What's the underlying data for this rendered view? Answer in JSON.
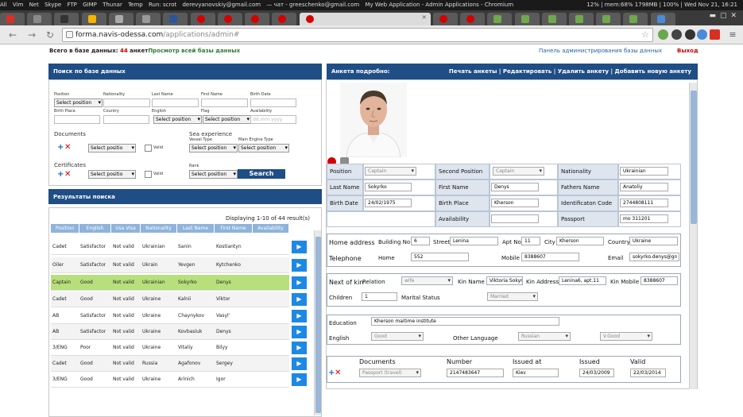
{
  "system": {
    "left_items": [
      "All",
      "Vim",
      "Net",
      "Skype",
      "FTP",
      "GIMP",
      "Thunar",
      "Temp",
      "Run: scrot"
    ],
    "chat_email": "derevyanovskiy@gmail.com",
    "chat_rest": "— чат - greeschenko@gmail.com",
    "window_title": "My Web Application - Admin Applications - Chromium",
    "status": "12% | mem:68% 1798MB | 100% | Wed Nov 21, 16:21"
  },
  "browser": {
    "url_host": "forma.navis-odessa.com",
    "url_path": "/applications/admin#"
  },
  "page": {
    "stats_prefix": "Всего в базе данных: ",
    "stats_count": "44",
    "stats_suffix": " анкет",
    "view_all": "Просмотр всей базы данных",
    "admin_panel": "Панель администрирования базы данных",
    "logout": "Выход"
  },
  "search": {
    "header": "Поиск по базе данных",
    "labels": {
      "position": "Position",
      "nationality": "Nationality",
      "last_name": "Last Name",
      "first_name": "First Name",
      "birth_date": "Birth Date",
      "birth_place": "Birth Place",
      "country": "Country",
      "english": "English",
      "flag": "Flag",
      "availability": "Availability",
      "documents": "Documents",
      "certificates": "Certificates",
      "sea_experience": "Sea experience",
      "vessel_type": "Vessel Type",
      "main_engine_type": "Main Engine Type",
      "rank": "Rank",
      "valid": "Valid"
    },
    "select_position": "Select position",
    "select_position_short": "Select positio",
    "date_placeholder": "dd.mm.yyyy",
    "button": "Search"
  },
  "results": {
    "header": "Результаты поиска",
    "displaying": "Displaying 1-10 of 44 result(s)",
    "columns": [
      "Position",
      "English",
      "Usa Visa",
      "Nationality",
      "Last Name",
      "First Name",
      "Availability"
    ],
    "rows": [
      [
        "Cadet",
        "Satisfactor",
        "Not valid",
        "Ukrainian",
        "Sanin",
        "Kostiantyn",
        ""
      ],
      [
        "Oiler",
        "Satisfactor",
        "Not valid",
        "Ukrain",
        "Yevgen",
        "Kytchenko",
        ""
      ],
      [
        "Captain",
        "Good",
        "Not valid",
        "Ukrainian",
        "Sokyrko",
        "Denys",
        ""
      ],
      [
        "Cadet",
        "Good",
        "Not valid",
        "Ukraine",
        "Kalnii",
        "Viktor",
        ""
      ],
      [
        "AB",
        "Satisfactor",
        "Not valid",
        "Ukraine",
        "Chaynykov",
        "Vasyl'",
        ""
      ],
      [
        "AB",
        "Satisfactor",
        "Not valid",
        "Ukraine",
        "Kovbasiuk",
        "Denys",
        ""
      ],
      [
        "3/ENG",
        "Poor",
        "Not valid",
        "Ukraine",
        "Vitaliy",
        "Bilyy",
        ""
      ],
      [
        "Cadet",
        "Good",
        "Not valid",
        "Russia",
        "Agafonov",
        "Sergey",
        ""
      ],
      [
        "3/ENG",
        "Good",
        "Not valid",
        "Ukraine",
        "Arinich",
        "Igor",
        ""
      ]
    ]
  },
  "detail": {
    "header": "Анкета подробно:",
    "actions": "Печать анкеты | Редактировать | Удалить анкету | Добавить новую анкету",
    "position_label": "Position",
    "position_value": "Captain",
    "second_position_label": "Second Position",
    "second_position_value": "Captain",
    "nationality_label": "Nationality",
    "nationality_value": "Ukrainian",
    "last_name_label": "Last Name",
    "last_name_value": "Sokyrko",
    "first_name_label": "First Name",
    "first_name_value": "Denys",
    "fathers_name_label": "Fathers Name",
    "fathers_name_value": "Anatoliy",
    "birth_date_label": "Birth Date",
    "birth_date_value": "24/02/1975",
    "birth_place_label": "Birth Place",
    "birth_place_value": "Kherson",
    "ident_code_label": "Identificaton Code",
    "ident_code_value": "2744808111",
    "availability_label": "Availability",
    "passport_label": "Passport",
    "passport_value": "mo 311201",
    "home_address_label": "Home address",
    "building_label": "Building No",
    "building_value": "6",
    "street_label": "Street",
    "street_value": "Lenina",
    "apt_label": "Apt No",
    "apt_value": "11",
    "city_label": "City",
    "city_value": "Kherson",
    "country_label": "Country",
    "country_value": "Ukraine",
    "telephone_label": "Telephone",
    "home_label": "Home",
    "home_value": "552",
    "mobile_label": "Mobile",
    "mobile_value": "8388607",
    "email_label": "Email",
    "email_value": "sokyrko.denys@gn",
    "next_of_kin_label": "Next of kin",
    "relation_label": "Relation",
    "relation_value": "wife",
    "kin_name_label": "Kin Name",
    "kin_name_value": "Viktoria Sokyr",
    "kin_address_label": "Kin Address",
    "kin_address_value": "Lenina6, apt.11",
    "kin_mobile_label": "Kin Mobile",
    "kin_mobile_value": "8388607",
    "children_label": "Children",
    "children_value": "1",
    "marital_label": "Marital Status",
    "marital_value": "Married",
    "education_label": "Education",
    "education_value": "Kherson maitime institute",
    "english_label": "English",
    "english_value": "Good",
    "other_lang_label": "Other Language",
    "other_lang_value": "Russian",
    "other_lang_level": "V.Good",
    "doc_cols": [
      "Documents",
      "Number",
      "Issued at",
      "Issued",
      "Valid"
    ],
    "doc_type": "Passport (travel)",
    "doc_number": "2147483647",
    "doc_issued_at": "Kiev",
    "doc_issued": "24/03/2009",
    "doc_valid": "22/03/2014"
  }
}
